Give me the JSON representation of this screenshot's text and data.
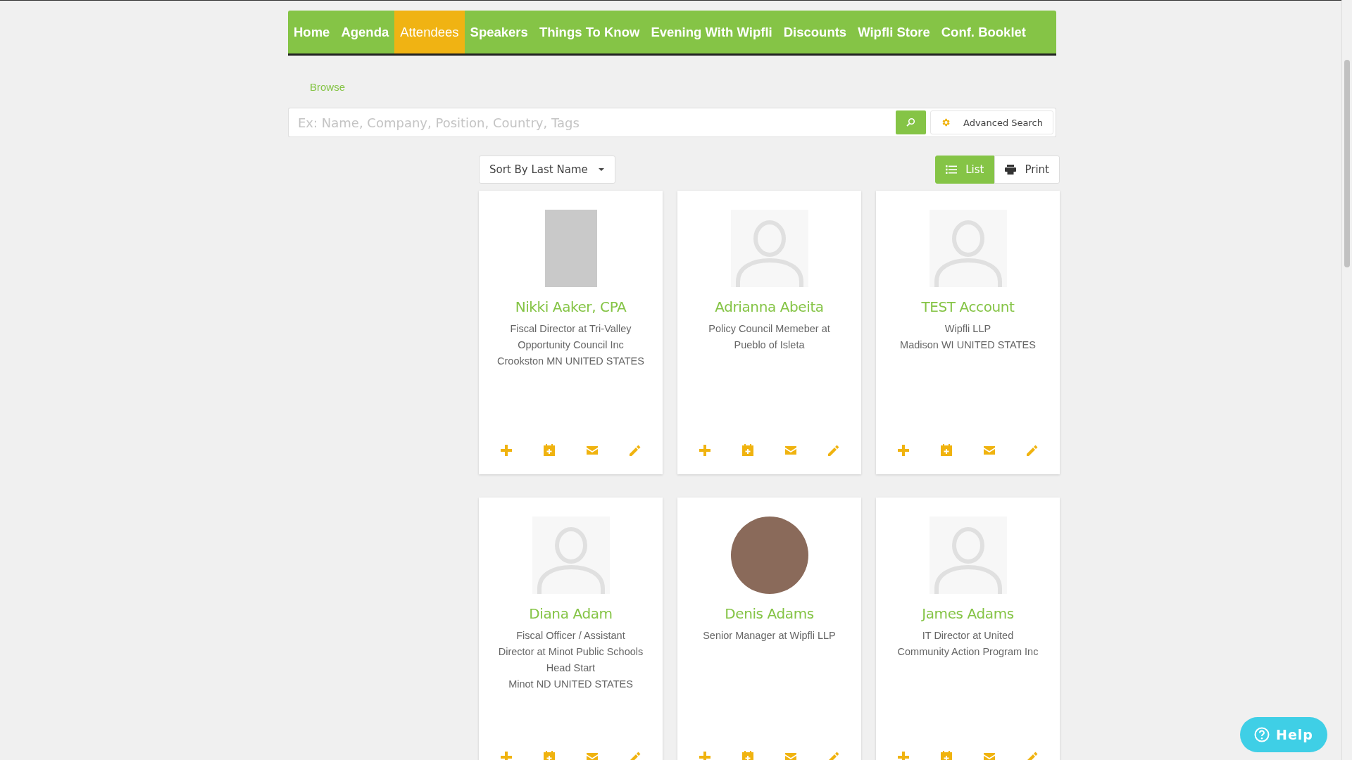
{
  "nav": [
    {
      "label": "Home",
      "selected": false
    },
    {
      "label": "Agenda",
      "selected": false
    },
    {
      "label": "Attendees",
      "selected": true
    },
    {
      "label": "Speakers",
      "selected": false
    },
    {
      "label": "Things To Know",
      "selected": false
    },
    {
      "label": "Evening With Wipfli",
      "selected": false
    },
    {
      "label": "Discounts",
      "selected": false
    },
    {
      "label": "Wipfli Store",
      "selected": false
    },
    {
      "label": "Conf. Booklet",
      "selected": false
    }
  ],
  "breadcrumb": "Browse",
  "search": {
    "placeholder": "Ex: Name, Company, Position, Country, Tags"
  },
  "advanced_search": "Advanced Search",
  "sort": "Sort By Last Name",
  "view_buttons": [
    {
      "label": "List",
      "kind": "list",
      "selected": true
    },
    {
      "label": "Print",
      "kind": "print",
      "selected": false
    }
  ],
  "attendees": [
    {
      "name": "Nikki Aaker, CPA",
      "kind": "portrait",
      "lines": [
        "Fiscal Director at Tri-Valley",
        "Opportunity Council Inc",
        "Crookston MN UNITED STATES"
      ]
    },
    {
      "name": "Adrianna Abeita",
      "kind": "placeholder",
      "lines": [
        "Policy Council Memeber at",
        "Pueblo of Isleta"
      ]
    },
    {
      "name": "TEST Account",
      "kind": "placeholder",
      "lines": [
        "Wipfli LLP",
        "Madison WI UNITED STATES"
      ]
    },
    {
      "name": "Diana Adam",
      "kind": "placeholder",
      "lines": [
        "Fiscal Officer / Assistant",
        "Director at Minot Public Schools",
        "Head Start",
        "Minot ND UNITED STATES"
      ]
    },
    {
      "name": "Denis Adams",
      "kind": "round",
      "lines": [
        "Senior Manager at Wipfli LLP"
      ]
    },
    {
      "name": "James Adams",
      "kind": "placeholder",
      "lines": [
        "IT Director at United",
        "Community Action Program Inc"
      ]
    }
  ],
  "help": "Help"
}
